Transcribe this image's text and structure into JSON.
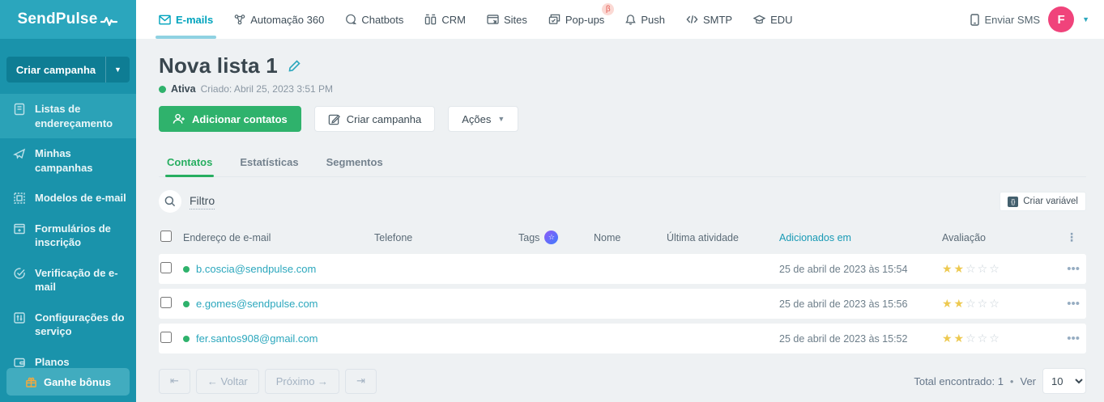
{
  "brand": {
    "name": "SendPulse"
  },
  "topnav": {
    "items": [
      {
        "label": "E-mails",
        "active": true
      },
      {
        "label": "Automação 360"
      },
      {
        "label": "Chatbots"
      },
      {
        "label": "CRM"
      },
      {
        "label": "Sites"
      },
      {
        "label": "Pop-ups",
        "badge": "β"
      },
      {
        "label": "Push"
      },
      {
        "label": "SMTP"
      },
      {
        "label": "EDU"
      }
    ],
    "send_sms": "Enviar SMS",
    "avatar_letter": "F"
  },
  "sidebar": {
    "create_campaign": "Criar campanha",
    "items": [
      {
        "label": "Listas de endereçamento",
        "active": true
      },
      {
        "label": "Minhas campanhas"
      },
      {
        "label": "Modelos de e-mail"
      },
      {
        "label": "Formulários de inscrição"
      },
      {
        "label": "Verificação de e-mail"
      },
      {
        "label": "Configurações do serviço"
      },
      {
        "label": "Planos"
      }
    ],
    "bonus_label": "Ganhe bônus"
  },
  "page": {
    "title": "Nova lista 1",
    "status": "Ativa",
    "created": "Criado: Abril 25, 2023 3:51 PM",
    "add_contacts": "Adicionar contatos",
    "create_campaign": "Criar campanha",
    "actions": "Ações"
  },
  "tabs": [
    {
      "label": "Contatos",
      "active": true
    },
    {
      "label": "Estatísticas"
    },
    {
      "label": "Segmentos"
    }
  ],
  "filter": {
    "label": "Filtro",
    "create_variable": "Criar variável",
    "variable_icon": "{}"
  },
  "table": {
    "columns": [
      "Endereço de e-mail",
      "Telefone",
      "Tags",
      "Nome",
      "Última atividade",
      "Adicionados em",
      "Avaliação"
    ],
    "sorted_column": "Adicionados em",
    "rows": [
      {
        "email": "b.coscia@sendpulse.com",
        "added": "25 de abril de 2023 às 15:54",
        "rating": 2,
        "stars_filled": "★★",
        "stars_empty": "☆☆☆"
      },
      {
        "email": "e.gomes@sendpulse.com",
        "added": "25 de abril de 2023 às 15:56",
        "rating": 2,
        "stars_filled": "★★",
        "stars_empty": "☆☆☆"
      },
      {
        "email": "fer.santos908@gmail.com",
        "added": "25 de abril de 2023 às 15:52",
        "rating": 2,
        "stars_filled": "★★",
        "stars_empty": "☆☆☆"
      }
    ]
  },
  "pagination": {
    "first": "⇤",
    "back": "← Voltar",
    "next": "Próximo →",
    "last": "⇥",
    "total": "Total encontrado: 1",
    "separator": "•",
    "view_label": "Ver",
    "per_page": "10"
  },
  "colors": {
    "sidebar": "#1a93ab",
    "sidebar_header": "#2ba6bd",
    "accent_teal": "#00a3bd",
    "accent_green": "#2fb26c",
    "avatar_pink": "#f0437b",
    "star_gold": "#edc950"
  }
}
